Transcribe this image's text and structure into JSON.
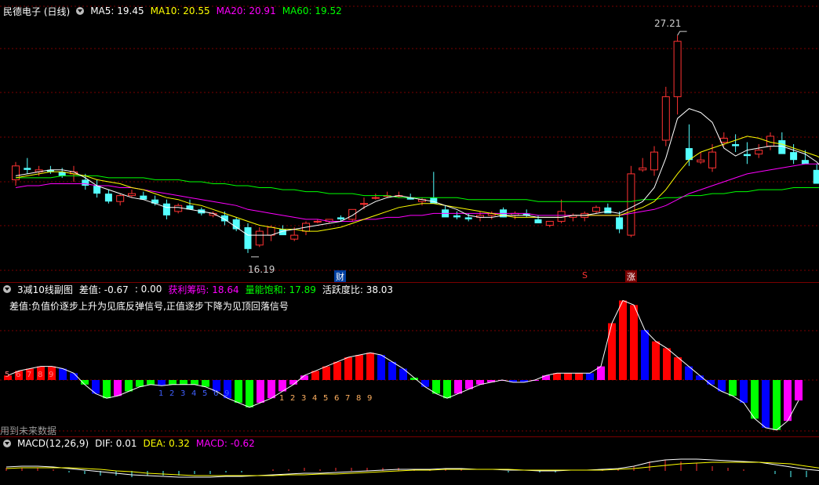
{
  "main_header": {
    "title": "民德电子 (日线)",
    "ma5": "MA5: 19.45",
    "ma10": "MA10: 20.55",
    "ma20": "MA20: 20.91",
    "ma60": "MA60: 19.52"
  },
  "main_labels": {
    "high": "27.21",
    "low": "16.19"
  },
  "event_markers": {
    "cai": "财",
    "s": "S",
    "zhang": "涨"
  },
  "sub_header": {
    "title": "3减10线副图",
    "diff": "差值: -0.67",
    "zero": ": 0.00",
    "profit": "获利筹码: 18.64",
    "volume": "量能饱和: 17.89",
    "activity": "活跃度比: 38.03",
    "note": "差值:负值价逐步上升为见底反弹信号,正值逐步下降为见顶回落信号",
    "footer": "用到未来数据"
  },
  "macd_header": {
    "title": "MACD(12,26,9)",
    "dif": "DIF: 0.01",
    "dea": "DEA: 0.32",
    "macd": "MACD: -0.62"
  },
  "colors": {
    "up": "#ff3232",
    "down": "#54ffff",
    "ma5": "#ffffff",
    "ma10": "#ffff00",
    "ma20": "#ff00ff",
    "ma60": "#00ff00",
    "bar_red": "#ff0000",
    "bar_green": "#00ff00",
    "bar_blue": "#0000ff",
    "bar_magenta": "#ff00ff",
    "grid": "#7a0000"
  },
  "chart_data": {
    "type": "candlestick",
    "price_axis_visible": false,
    "candles_ohlc": [
      [
        19.9,
        20.8,
        19.6,
        20.6
      ],
      [
        20.5,
        21.0,
        20.2,
        20.4
      ],
      [
        20.3,
        20.6,
        20.1,
        20.4
      ],
      [
        20.4,
        20.6,
        20.2,
        20.3
      ],
      [
        20.3,
        20.5,
        20.0,
        20.1
      ],
      [
        20.2,
        20.6,
        19.8,
        20.3
      ],
      [
        19.9,
        20.2,
        19.4,
        19.6
      ],
      [
        19.6,
        19.9,
        19.0,
        19.2
      ],
      [
        19.2,
        19.4,
        18.7,
        18.8
      ],
      [
        18.8,
        19.2,
        18.6,
        19.1
      ],
      [
        19.1,
        19.4,
        19.0,
        19.2
      ],
      [
        19.1,
        19.3,
        18.9,
        18.9
      ],
      [
        18.9,
        19.1,
        18.6,
        18.7
      ],
      [
        18.7,
        18.9,
        17.9,
        18.1
      ],
      [
        18.3,
        18.7,
        18.2,
        18.6
      ],
      [
        18.6,
        18.9,
        18.5,
        18.4
      ],
      [
        18.4,
        18.5,
        18.1,
        18.2
      ],
      [
        18.1,
        18.3,
        18.0,
        18.2
      ],
      [
        18.1,
        18.3,
        17.6,
        17.8
      ],
      [
        17.9,
        18.0,
        17.3,
        17.4
      ],
      [
        17.5,
        17.7,
        16.2,
        16.4
      ],
      [
        16.6,
        17.5,
        16.5,
        17.3
      ],
      [
        17.1,
        17.6,
        16.8,
        17.5
      ],
      [
        17.4,
        17.6,
        17.2,
        17.1
      ],
      [
        16.9,
        17.5,
        16.8,
        17.1
      ],
      [
        17.3,
        17.8,
        17.1,
        17.7
      ],
      [
        17.8,
        17.9,
        17.7,
        17.8
      ],
      [
        17.8,
        17.9,
        17.7,
        17.9
      ],
      [
        18.0,
        18.1,
        17.8,
        17.9
      ],
      [
        17.9,
        18.4,
        17.8,
        18.4
      ],
      [
        18.7,
        19.0,
        18.4,
        18.7
      ],
      [
        19.0,
        19.2,
        18.9,
        19.0
      ],
      [
        19.1,
        19.3,
        19.0,
        19.1
      ],
      [
        19.1,
        19.3,
        19.0,
        19.1
      ],
      [
        19.0,
        19.2,
        18.9,
        18.9
      ],
      [
        18.8,
        19.0,
        18.6,
        18.9
      ],
      [
        19.0,
        20.3,
        18.7,
        18.7
      ],
      [
        18.4,
        18.6,
        18.1,
        18.0
      ],
      [
        18.1,
        18.3,
        17.9,
        18.0
      ],
      [
        18.0,
        18.2,
        17.8,
        17.9
      ],
      [
        18.0,
        18.3,
        17.8,
        18.1
      ],
      [
        18.1,
        18.3,
        17.9,
        18.2
      ],
      [
        18.4,
        18.5,
        18.0,
        18.0
      ],
      [
        18.1,
        18.3,
        17.9,
        18.2
      ],
      [
        18.2,
        18.4,
        18.0,
        18.1
      ],
      [
        17.9,
        18.1,
        17.7,
        17.7
      ],
      [
        17.6,
        17.8,
        17.5,
        17.8
      ],
      [
        17.8,
        18.9,
        17.7,
        18.3
      ],
      [
        18.0,
        18.2,
        17.8,
        18.1
      ],
      [
        18.0,
        18.3,
        17.8,
        18.2
      ],
      [
        18.3,
        18.6,
        18.2,
        18.5
      ],
      [
        18.5,
        18.7,
        18.3,
        18.2
      ],
      [
        18.0,
        18.3,
        17.2,
        17.4
      ],
      [
        17.1,
        20.6,
        17.0,
        20.2
      ],
      [
        20.4,
        21.0,
        20.3,
        20.5
      ],
      [
        20.4,
        21.6,
        20.1,
        21.3
      ],
      [
        21.9,
        24.6,
        21.6,
        24.1
      ],
      [
        24.1,
        27.2,
        23.2,
        26.9
      ],
      [
        21.5,
        22.7,
        20.6,
        20.9
      ],
      [
        20.8,
        21.3,
        20.7,
        20.9
      ],
      [
        20.5,
        21.7,
        20.3,
        21.3
      ],
      [
        21.8,
        22.3,
        21.6,
        22.0
      ],
      [
        21.7,
        22.2,
        21.3,
        21.6
      ],
      [
        21.2,
        21.8,
        20.7,
        21.1
      ],
      [
        21.2,
        21.7,
        21.0,
        21.4
      ],
      [
        21.6,
        22.3,
        21.4,
        22.1
      ],
      [
        21.9,
        22.3,
        21.8,
        21.2
      ],
      [
        21.3,
        21.7,
        20.7,
        20.9
      ],
      [
        20.9,
        21.4,
        20.8,
        20.7
      ],
      [
        20.4,
        20.7,
        19.7,
        19.7
      ],
      [
        19.2,
        19.7,
        18.6,
        18.6
      ],
      [
        18.6,
        19.0,
        18.3,
        18.8
      ],
      [
        19.2,
        20.1,
        18.9,
        19.4
      ],
      [
        19.2,
        19.7,
        19.0,
        19.2
      ],
      [
        19.1,
        19.4,
        18.9,
        19.3
      ],
      [
        19.4,
        19.7,
        19.2,
        19.5
      ]
    ],
    "ma5": [
      20.1,
      20.2,
      20.3,
      20.4,
      20.4,
      20.3,
      20.0,
      19.6,
      19.4,
      19.2,
      19.0,
      18.9,
      18.7,
      18.5,
      18.5,
      18.4,
      18.3,
      18.2,
      17.9,
      17.5,
      17.1,
      17.1,
      17.1,
      17.3,
      17.4,
      17.5,
      17.6,
      17.7,
      17.8,
      18.1,
      18.5,
      18.8,
      19.0,
      19.1,
      19.0,
      18.9,
      18.8,
      18.6,
      18.4,
      18.1,
      18.0,
      18.0,
      18.1,
      18.1,
      18.1,
      18.0,
      18.0,
      18.0,
      18.1,
      18.1,
      18.2,
      18.3,
      18.2,
      18.5,
      18.8,
      19.5,
      21.0,
      23.0,
      23.5,
      23.3,
      22.8,
      21.5,
      21.1,
      21.4,
      21.5,
      21.6,
      21.6,
      21.4,
      21.2,
      20.8,
      20.1,
      19.6,
      19.4,
      19.1,
      19.1,
      19.2
    ],
    "ma10": [
      20.0,
      20.1,
      20.2,
      20.3,
      20.3,
      20.2,
      20.1,
      19.9,
      19.8,
      19.7,
      19.5,
      19.4,
      19.2,
      19.0,
      18.9,
      18.7,
      18.6,
      18.4,
      18.2,
      18.0,
      17.8,
      17.6,
      17.5,
      17.4,
      17.4,
      17.3,
      17.3,
      17.4,
      17.5,
      17.7,
      17.9,
      18.1,
      18.3,
      18.5,
      18.6,
      18.7,
      18.7,
      18.6,
      18.5,
      18.4,
      18.3,
      18.2,
      18.1,
      18.0,
      18.0,
      18.0,
      18.0,
      18.0,
      18.1,
      18.1,
      18.1,
      18.1,
      18.1,
      18.3,
      18.5,
      18.8,
      19.4,
      20.2,
      20.9,
      21.3,
      21.5,
      21.7,
      21.9,
      22.1,
      22.0,
      21.8,
      21.7,
      21.5,
      21.3,
      21.1,
      20.8,
      20.4,
      20.1,
      19.9,
      19.7,
      19.5
    ],
    "ma20": [
      19.5,
      19.6,
      19.6,
      19.7,
      19.7,
      19.7,
      19.7,
      19.6,
      19.6,
      19.5,
      19.5,
      19.4,
      19.3,
      19.2,
      19.1,
      19.0,
      18.9,
      18.8,
      18.7,
      18.6,
      18.4,
      18.3,
      18.2,
      18.1,
      18.0,
      17.9,
      17.9,
      17.8,
      17.8,
      17.8,
      17.9,
      17.9,
      18.0,
      18.0,
      18.1,
      18.1,
      18.2,
      18.2,
      18.2,
      18.2,
      18.2,
      18.2,
      18.2,
      18.2,
      18.2,
      18.1,
      18.1,
      18.1,
      18.1,
      18.1,
      18.1,
      18.1,
      18.1,
      18.2,
      18.3,
      18.4,
      18.6,
      18.9,
      19.2,
      19.4,
      19.6,
      19.8,
      20.0,
      20.2,
      20.3,
      20.4,
      20.5,
      20.6,
      20.7,
      20.7,
      20.8,
      20.8,
      20.8,
      20.8,
      20.9,
      20.9
    ],
    "ma60": [
      20.0,
      20.0,
      20.0,
      20.0,
      20.1,
      20.1,
      20.1,
      20.1,
      20.0,
      20.0,
      20.0,
      20.0,
      19.9,
      19.9,
      19.9,
      19.8,
      19.8,
      19.7,
      19.7,
      19.6,
      19.6,
      19.5,
      19.5,
      19.4,
      19.4,
      19.3,
      19.3,
      19.2,
      19.2,
      19.2,
      19.1,
      19.1,
      19.1,
      19.0,
      19.0,
      19.0,
      19.0,
      19.0,
      19.0,
      18.9,
      18.9,
      18.9,
      18.9,
      18.9,
      18.9,
      18.8,
      18.8,
      18.8,
      18.8,
      18.8,
      18.8,
      18.8,
      18.8,
      18.8,
      18.9,
      18.9,
      19.0,
      19.0,
      19.1,
      19.1,
      19.2,
      19.2,
      19.3,
      19.3,
      19.4,
      19.4,
      19.4,
      19.5,
      19.5,
      19.5,
      19.5,
      19.5,
      19.5,
      19.5,
      19.5,
      19.5
    ],
    "diff_bars": [
      0.4,
      0.8,
      1.0,
      1.2,
      1.2,
      1.0,
      0.6,
      -0.4,
      -1.2,
      -1.6,
      -1.4,
      -1.0,
      -0.6,
      -0.4,
      -0.5,
      -0.4,
      -0.4,
      -0.4,
      -0.6,
      -1.0,
      -1.6,
      -2.0,
      -2.4,
      -2.0,
      -1.6,
      -1.0,
      -0.4,
      0.4,
      0.8,
      1.2,
      1.6,
      2.0,
      2.2,
      2.4,
      2.2,
      1.6,
      1.0,
      0.2,
      -0.6,
      -1.2,
      -1.6,
      -1.2,
      -0.8,
      -0.4,
      -0.2,
      0.0,
      -0.2,
      -0.2,
      0.0,
      0.4,
      0.6,
      0.6,
      0.6,
      0.6,
      1.2,
      5.0,
      7.0,
      6.6,
      4.4,
      3.4,
      2.8,
      2.0,
      1.2,
      0.4,
      -0.4,
      -1.0,
      -1.4,
      -2.0,
      -3.4,
      -4.2,
      -4.4,
      -3.6,
      -1.8
    ],
    "diff_bar_colors": [
      "bar_red",
      "bar_red",
      "bar_red",
      "bar_red",
      "bar_red",
      "bar_blue",
      "bar_blue",
      "bar_green",
      "bar_blue",
      "bar_green",
      "bar_magenta",
      "bar_green",
      "bar_green",
      "bar_green",
      "bar_blue",
      "bar_green",
      "bar_green",
      "bar_green",
      "bar_green",
      "bar_blue",
      "bar_blue",
      "bar_green",
      "bar_green",
      "bar_magenta",
      "bar_magenta",
      "bar_magenta",
      "bar_magenta",
      "bar_magenta",
      "bar_red",
      "bar_red",
      "bar_red",
      "bar_red",
      "bar_red",
      "bar_red",
      "bar_blue",
      "bar_blue",
      "bar_blue",
      "bar_green",
      "bar_blue",
      "bar_green",
      "bar_green",
      "bar_magenta",
      "bar_magenta",
      "bar_magenta",
      "bar_magenta",
      "bar_magenta",
      "bar_blue",
      "bar_blue",
      "bar_magenta",
      "bar_magenta",
      "bar_red",
      "bar_red",
      "bar_red",
      "bar_blue",
      "bar_magenta",
      "bar_red",
      "bar_red",
      "bar_red",
      "bar_blue",
      "bar_red",
      "bar_red",
      "bar_red",
      "bar_blue",
      "bar_blue",
      "bar_blue",
      "bar_blue",
      "bar_green",
      "bar_blue",
      "bar_green",
      "bar_blue",
      "bar_green",
      "bar_magenta",
      "bar_magenta"
    ],
    "count_labels_a": [
      "5",
      "6",
      "7",
      "8",
      "9"
    ],
    "count_labels_b": [
      "1",
      "2",
      "3",
      "4",
      "5",
      "6",
      "7",
      "8",
      "9"
    ],
    "count_labels_c": [
      "1",
      "2",
      "3",
      "4",
      "5",
      "6",
      "9"
    ],
    "dif": [
      0.5,
      0.6,
      0.6,
      0.5,
      0.3,
      0.1,
      -0.1,
      -0.3,
      -0.5,
      -0.6,
      -0.7,
      -0.8,
      -0.8,
      -0.8,
      -0.7,
      -0.7,
      -0.6,
      -0.5,
      -0.4,
      -0.3,
      -0.3,
      -0.2,
      -0.1,
      0.0,
      0.1,
      0.2,
      0.2,
      0.2,
      0.3,
      0.3,
      0.2,
      0.2,
      0.1,
      0.1,
      0.0,
      0.0,
      0.1,
      0.1,
      0.2,
      0.3,
      0.6,
      1.1,
      1.4,
      1.5,
      1.5,
      1.4,
      1.3,
      1.2,
      1.1,
      0.8,
      0.5,
      0.2,
      0.01
    ],
    "dea": [
      0.3,
      0.4,
      0.4,
      0.4,
      0.4,
      0.3,
      0.2,
      0.0,
      -0.1,
      -0.3,
      -0.4,
      -0.5,
      -0.6,
      -0.6,
      -0.6,
      -0.6,
      -0.6,
      -0.6,
      -0.5,
      -0.5,
      -0.4,
      -0.4,
      -0.3,
      -0.2,
      -0.1,
      0.0,
      0.1,
      0.1,
      0.2,
      0.2,
      0.2,
      0.2,
      0.2,
      0.1,
      0.1,
      0.1,
      0.1,
      0.1,
      0.1,
      0.2,
      0.3,
      0.5,
      0.7,
      0.9,
      1.0,
      1.1,
      1.1,
      1.1,
      1.1,
      1.0,
      0.9,
      0.6,
      0.32
    ]
  }
}
